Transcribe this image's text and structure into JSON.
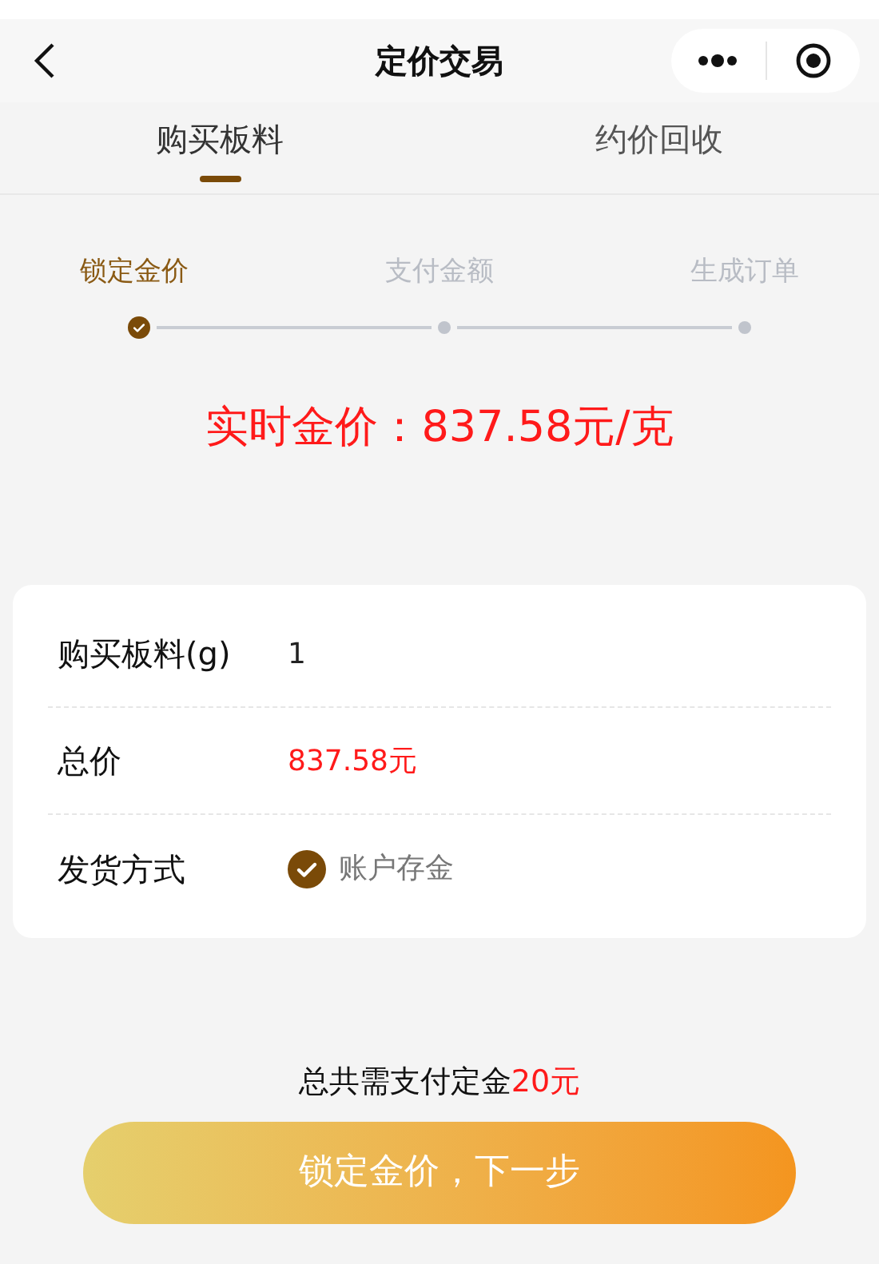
{
  "nav_bar": {
    "title": "定价交易"
  },
  "tabs": [
    {
      "label": "购买板料",
      "selected": true
    },
    {
      "label": "约价回收",
      "selected": false
    }
  ],
  "steps": [
    {
      "label": "锁定金价",
      "completed": true
    },
    {
      "label": "支付金额",
      "completed": false
    },
    {
      "label": "生成订单",
      "completed": false
    }
  ],
  "live_price": "实时金价：837.58元/克",
  "form": [
    {
      "kind": "text",
      "label": "购买板料(g)",
      "value": "1"
    },
    {
      "kind": "price",
      "label": "总价",
      "value": "837.58元"
    },
    {
      "kind": "option",
      "label": "发货方式",
      "value": "账户存金",
      "checked": true
    }
  ],
  "deposit_note": {
    "text": "总共需支付定金",
    "amount": "20元"
  },
  "next_button": "锁定金价，下一步"
}
